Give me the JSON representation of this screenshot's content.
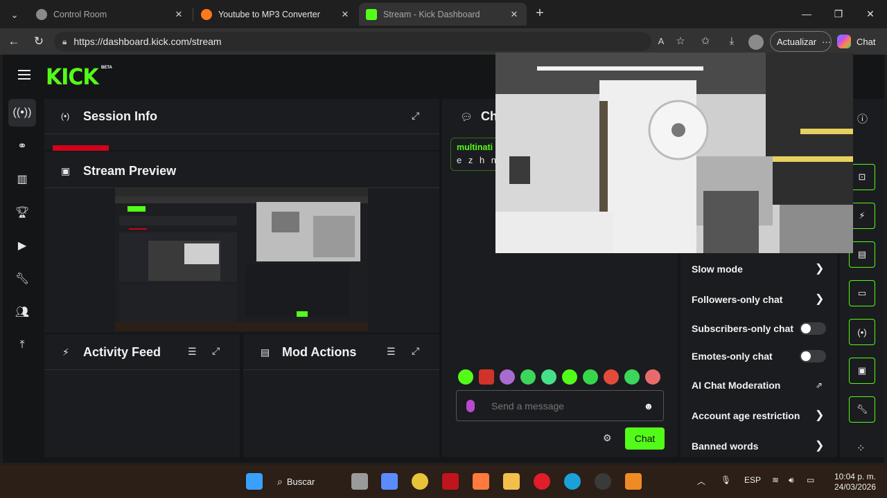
{
  "browser": {
    "tabs": [
      {
        "title": "Control Room",
        "favicon_color": "#9a9a9a",
        "active": false
      },
      {
        "title": "Youtube to MP3 Converter",
        "favicon_color": "#ff7a1a",
        "active": false
      },
      {
        "title": "Stream - Kick Dashboard",
        "favicon_color": "#53fc18",
        "active": true
      }
    ],
    "url": "https://dashboard.kick.com/stream",
    "update_label": "Actualizar",
    "update_more": "···",
    "copilot_label": "Chat"
  },
  "brand": {
    "logo": "KICK",
    "badge": "BETA",
    "accent_color": "#53fc18"
  },
  "left_rail": [
    "stream-icon",
    "link-icon",
    "chart-icon",
    "trophy-icon",
    "video-icon",
    "wrench-icon",
    "users-icon",
    "upload-icon"
  ],
  "panels": {
    "session_info": {
      "title": "Session Info"
    },
    "stream_preview": {
      "title": "Stream Preview"
    },
    "activity_feed": {
      "title": "Activity Feed"
    },
    "mod_actions": {
      "title": "Mod Actions"
    },
    "chat": {
      "title": "Ch"
    }
  },
  "chat": {
    "message": {
      "user": "multinati",
      "text": "e z h n a"
    },
    "input_placeholder": "Send a message",
    "send_label": "Chat"
  },
  "chat_settings": [
    {
      "label": "Slow mode",
      "control": "chevron"
    },
    {
      "label": "Followers-only chat",
      "control": "chevron"
    },
    {
      "label": "Subscribers-only chat",
      "control": "toggle",
      "enabled": false
    },
    {
      "label": "Emotes-only chat",
      "control": "toggle",
      "enabled": false
    },
    {
      "label": "AI Chat Moderation",
      "control": "external"
    },
    {
      "label": "Account age restriction",
      "control": "chevron"
    },
    {
      "label": "Banned words",
      "control": "chevron"
    }
  ],
  "taskbar": {
    "search_label": "Buscar",
    "lang": "ESP",
    "time": "10:04 p. m.",
    "date": "24/03/2026"
  }
}
